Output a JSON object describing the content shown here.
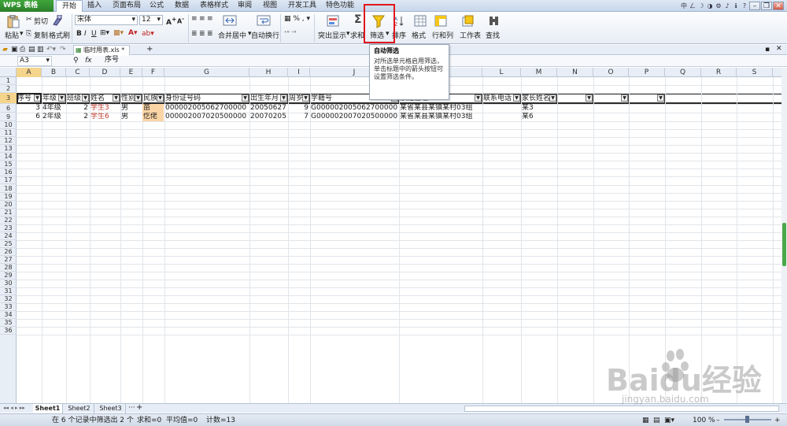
{
  "app": {
    "logo": "WPS 表格"
  },
  "menus": [
    "开始",
    "插入",
    "页面布局",
    "公式",
    "数据",
    "表格样式",
    "审阅",
    "视图",
    "开发工具",
    "特色功能"
  ],
  "window_controls": [
    "中",
    "ㄥ",
    "☽",
    "◑",
    "⚙",
    "♪",
    "ℹ",
    "?"
  ],
  "ribbon": {
    "paste": "粘贴",
    "cut": "剪切",
    "copy": "复制",
    "format_painter": "格式刷",
    "font_name": "宋体",
    "font_size": "12",
    "merge": "合并居中",
    "wrap": "自动换行",
    "number_format": "% ,",
    "highlight": "突出显示",
    "sum": "求和",
    "filter": "筛选",
    "sort": "排序",
    "format": "格式",
    "rowcol": "行和列",
    "worksheet": "工作表",
    "find": "查找"
  },
  "tooltip": {
    "title": "自动筛选",
    "body": "对所选单元格启用筛选，单击标题中的箭头按钮可设置筛选条件。"
  },
  "document_tab": "临时用表.xls *",
  "formula_bar": {
    "cell_ref": "A3",
    "fx": "fx",
    "content": "序号"
  },
  "columns": [
    "A",
    "B",
    "C",
    "D",
    "E",
    "F",
    "G",
    "H",
    "I",
    "J",
    "K",
    "L",
    "M",
    "N",
    "O",
    "P",
    "Q",
    "R",
    "S"
  ],
  "row_numbers": [
    "1",
    "2",
    "3",
    "6",
    "9",
    "10",
    "11",
    "12",
    "13",
    "14",
    "15",
    "16",
    "17",
    "18",
    "19",
    "20",
    "21",
    "22",
    "23",
    "24",
    "25",
    "26",
    "27",
    "28",
    "29",
    "30",
    "31",
    "32",
    "33",
    "34",
    "35",
    "36"
  ],
  "headers": [
    "序号",
    "年级",
    "班级",
    "姓名",
    "性别",
    "民族",
    "身份证号码",
    "出生年月",
    "周岁",
    "学籍号",
    "家庭住址",
    "联系电话",
    "家长姓名",
    "",
    "",
    ""
  ],
  "rows": [
    {
      "seq": "3",
      "grade": "4年级",
      "class": "2",
      "name": "学生3",
      "gender": "男",
      "ethnic": "苗",
      "id": "000002005062700000",
      "birth": "20050627",
      "age": "9",
      "xueji": "G000002005062700000",
      "addr": "某省某县某镇某村03组",
      "phone": "",
      "parent": "某3"
    },
    {
      "seq": "6",
      "grade": "2年级",
      "class": "2",
      "name": "学生6",
      "gender": "男",
      "ethnic": "仡佬",
      "id": "000002007020500000",
      "birth": "20070205",
      "age": "7",
      "xueji": "G000002007020500000",
      "addr": "某省某县某镇某村03组",
      "phone": "",
      "parent": "某6"
    }
  ],
  "sheets": [
    "Sheet1",
    "Sheet2",
    "Sheet3"
  ],
  "status": {
    "filter": "在 6 个记录中筛选出 2 个",
    "sum": "求和=0",
    "avg": "平均值=0",
    "count": "计数=13",
    "zoom": "100 %"
  },
  "watermark": {
    "brand": "Baidu经验",
    "url": "jingyan.baidu.com"
  },
  "colors": {
    "accent_green": "#2b7f2b",
    "highlight_red": "#e0161b",
    "selection": "#f5d48b",
    "ethnic_fill": "#fbd5a6"
  }
}
